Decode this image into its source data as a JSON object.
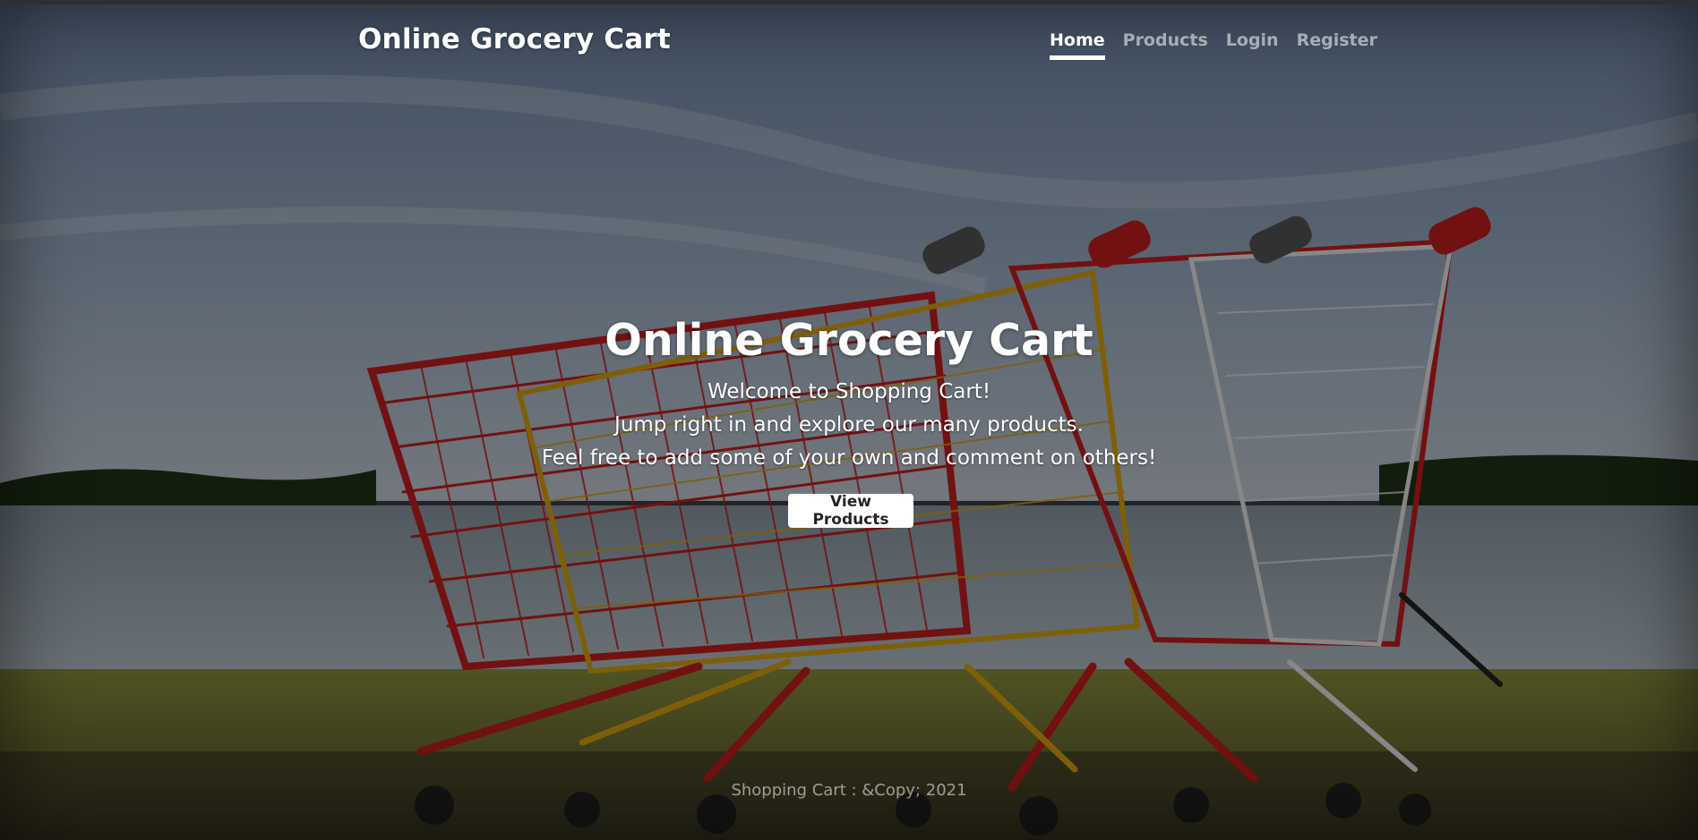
{
  "header": {
    "brand": "Online Grocery Cart",
    "nav": [
      {
        "label": "Home",
        "active": true
      },
      {
        "label": "Products",
        "active": false
      },
      {
        "label": "Login",
        "active": false
      },
      {
        "label": "Register",
        "active": false
      }
    ]
  },
  "hero": {
    "title": "Online Grocery Cart",
    "lines": [
      "Welcome to Shopping Cart!",
      "Jump right in and explore our many products.",
      "Feel free to add some of your own and comment on others!"
    ],
    "button_label": "View Products",
    "background_image": "shopping-carts-by-lake"
  },
  "footer": {
    "text": "Shopping Cart : &Copy; 2021"
  },
  "colors": {
    "cart_red": "#c41e1e",
    "cart_yellow": "#d9a411",
    "cart_white": "#e8e8e8",
    "sky": "#7f96b3",
    "water": "#9aa9b4",
    "grass": "#6f7a2c"
  }
}
